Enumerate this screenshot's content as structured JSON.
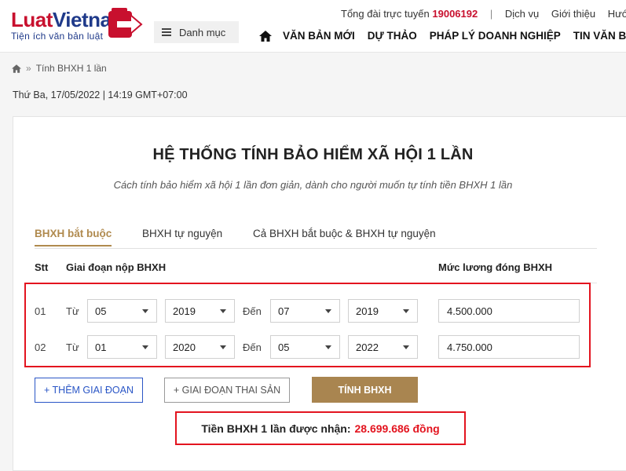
{
  "header": {
    "logo_part1": "Luat",
    "logo_part2": "Vietnam",
    "logo_tagline": "Tiện ích văn bản luật",
    "menu_label": "Danh mục",
    "hotline_label": "Tổng đài trực tuyến",
    "hotline_number": "19006192",
    "top_links": [
      "Dịch vụ",
      "Giới thiệu",
      "Hướng"
    ],
    "nav_items": [
      "VĂN BẢN MỚI",
      "DỰ THẢO",
      "PHÁP LÝ DOANH NGHIỆP",
      "TIN VĂN BẢ"
    ]
  },
  "breadcrumb": {
    "current": "Tính BHXH 1 lần"
  },
  "datetime": "Thứ Ba, 17/05/2022 | 14:19 GMT+07:00",
  "calculator": {
    "title": "HỆ THỐNG TÍNH BẢO HIỂM XÃ HỘI 1 LẦN",
    "subtitle": "Cách tính bảo hiểm xã hội 1 lần đơn giản, dành cho người muốn tự tính tiền BHXH 1 lần",
    "tabs": [
      "BHXH bắt buộc",
      "BHXH tự nguyện",
      "Cả BHXH bắt buộc & BHXH tự nguyện"
    ],
    "active_tab": "BHXH bắt buộc",
    "columns": {
      "stt": "Stt",
      "period": "Giai đoạn nộp BHXH",
      "salary": "Mức lương đóng BHXH"
    },
    "from_label": "Từ",
    "to_label": "Đến",
    "rows": [
      {
        "stt": "01",
        "from_month": "05",
        "from_year": "2019",
        "to_month": "07",
        "to_year": "2019",
        "salary": "4.500.000"
      },
      {
        "stt": "02",
        "from_month": "01",
        "from_year": "2020",
        "to_month": "05",
        "to_year": "2022",
        "salary": "4.750.000"
      }
    ],
    "buttons": {
      "add_period": "+ THÊM GIAI ĐOẠN",
      "add_maternity": "+ GIAI ĐOẠN THAI SẢN",
      "calculate": "TÍNH BHXH"
    },
    "result_label": "Tiền BHXH 1 lần được nhận:",
    "result_value": "28.699.686 đồng"
  },
  "colors": {
    "brand_red": "#c8102e",
    "brand_blue": "#1f3a8a",
    "accent_gold": "#a98550",
    "highlight_red": "#e3141f",
    "link_blue": "#2a56c6"
  }
}
